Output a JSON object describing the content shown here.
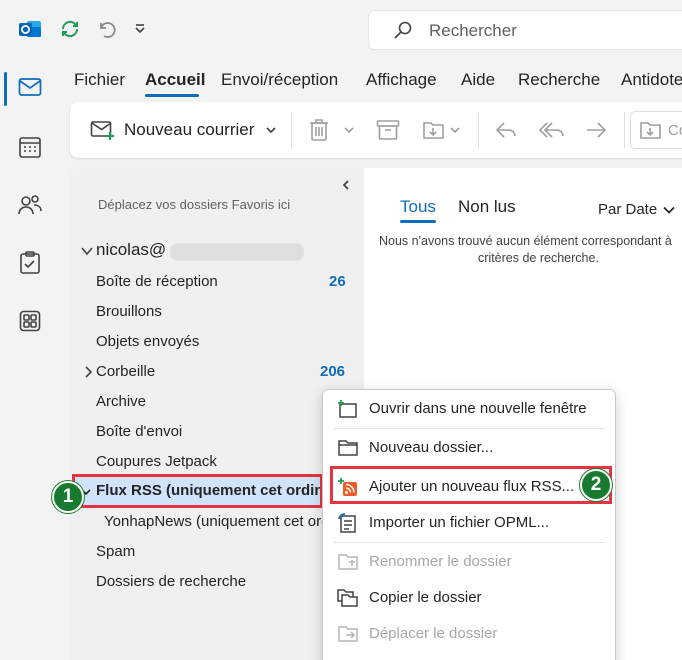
{
  "search": {
    "placeholder": "Rechercher"
  },
  "ribbon": {
    "tabs": [
      {
        "label": "Fichier"
      },
      {
        "label": "Accueil",
        "active": true
      },
      {
        "label": "Envoi/réception"
      },
      {
        "label": "Affichage"
      },
      {
        "label": "Aide"
      },
      {
        "label": "Recherche"
      },
      {
        "label": "Antidote"
      }
    ]
  },
  "toolbar": {
    "new_mail_label": "Nouveau courrier"
  },
  "folders": {
    "favorites_hint": "Déplacez vos dossiers Favoris ici",
    "account": "nicolas@",
    "items": [
      {
        "label": "Boîte de réception",
        "count": "26"
      },
      {
        "label": "Brouillons"
      },
      {
        "label": "Objets envoyés"
      },
      {
        "label": "Corbeille",
        "count": "206"
      },
      {
        "label": "Archive"
      },
      {
        "label": "Boîte d'envoi"
      },
      {
        "label": "Coupures Jetpack"
      },
      {
        "label": "Flux RSS (uniquement cet ordinateur)"
      },
      {
        "label": "YonhapNews (uniquement cet ordinateur)"
      },
      {
        "label": "Spam"
      },
      {
        "label": "Dossiers de recherche"
      }
    ]
  },
  "message_list": {
    "tab_all": "Tous",
    "tab_unread": "Non lus",
    "sort_label": "Par Date",
    "empty_line1": "Nous n'avons trouvé aucun élément correspondant à",
    "empty_line2": "critères de recherche."
  },
  "context_menu": {
    "items": [
      {
        "label": "Ouvrir dans une nouvelle fenêtre"
      },
      {
        "label": "Nouveau dossier..."
      },
      {
        "label": "Ajouter un nouveau flux RSS..."
      },
      {
        "label": "Importer un fichier OPML..."
      },
      {
        "label": "Renommer le dossier",
        "disabled": true
      },
      {
        "label": "Copier le dossier"
      },
      {
        "label": "Déplacer le dossier",
        "disabled": true
      }
    ]
  },
  "callouts": {
    "step1": "1",
    "step2": "2"
  },
  "colors": {
    "accent": "#0f6cbd",
    "highlight": "#e5343f",
    "badge": "#187a2e",
    "rss": "#f05a28"
  }
}
